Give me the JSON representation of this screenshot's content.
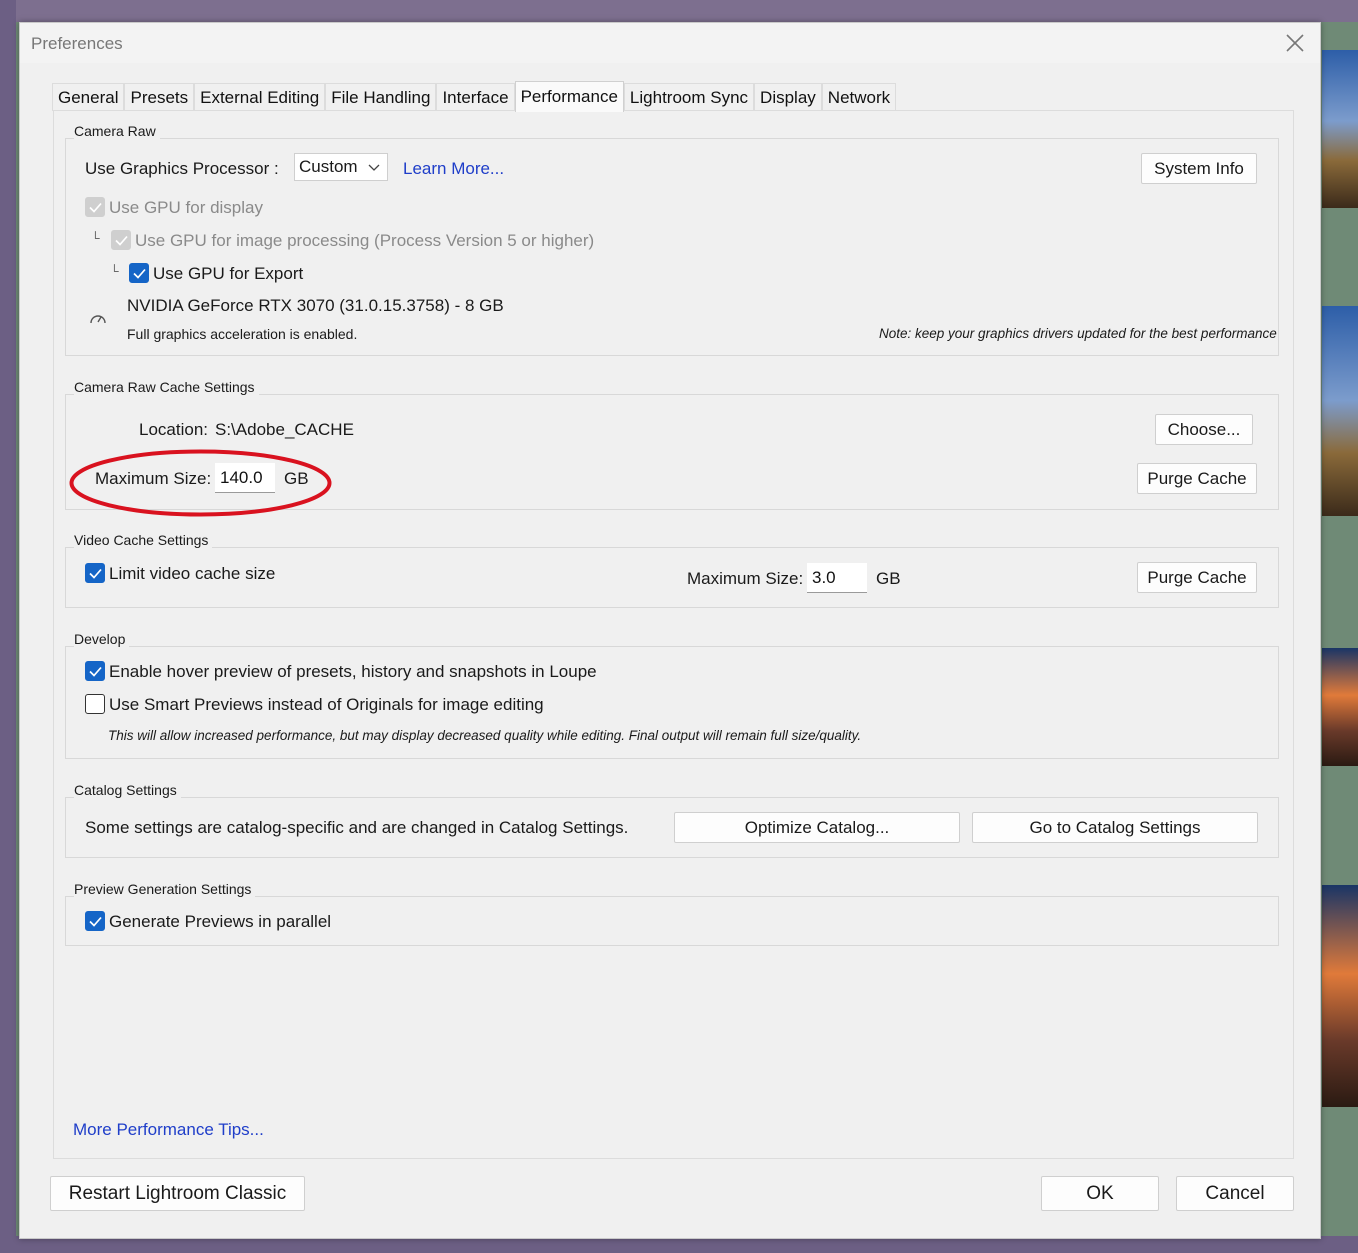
{
  "dialog": {
    "title": "Preferences"
  },
  "tabs": [
    {
      "label": "General"
    },
    {
      "label": "Presets"
    },
    {
      "label": "External Editing"
    },
    {
      "label": "File Handling"
    },
    {
      "label": "Interface"
    },
    {
      "label": "Performance"
    },
    {
      "label": "Lightroom Sync"
    },
    {
      "label": "Display"
    },
    {
      "label": "Network"
    }
  ],
  "active_tab": "Performance",
  "camera_raw": {
    "group_label": "Camera Raw",
    "use_gpu_label": "Use Graphics Processor :",
    "gpu_mode_value": "Custom",
    "learn_more": "Learn More...",
    "system_info_button": "System Info",
    "gpu_display": {
      "label": "Use GPU for display",
      "checked": true,
      "disabled": true
    },
    "gpu_processing": {
      "label": "Use GPU for image processing (Process Version 5 or higher)",
      "checked": true,
      "disabled": true
    },
    "gpu_export": {
      "label": "Use GPU for Export",
      "checked": true,
      "disabled": false
    },
    "gpu_name": "NVIDIA GeForce RTX 3070 (31.0.15.3758) - 8 GB",
    "acceleration_status": "Full graphics acceleration is enabled.",
    "driver_note": "Note: keep your graphics drivers updated for the best performance"
  },
  "camera_raw_cache": {
    "group_label": "Camera Raw Cache Settings",
    "location_label": "Location:",
    "location_value": "S:\\Adobe_CACHE",
    "choose_button": "Choose...",
    "max_size_label": "Maximum Size:",
    "max_size_value": "140.0",
    "max_size_unit": "GB",
    "purge_button": "Purge Cache"
  },
  "video_cache": {
    "group_label": "Video Cache Settings",
    "limit_label": "Limit video cache size",
    "limit_checked": true,
    "max_size_label": "Maximum Size:",
    "max_size_value": "3.0",
    "max_size_unit": "GB",
    "purge_button": "Purge Cache"
  },
  "develop": {
    "group_label": "Develop",
    "hover_preview": {
      "label": "Enable hover preview of presets, history and snapshots in Loupe",
      "checked": true
    },
    "smart_previews": {
      "label": "Use Smart Previews instead of Originals for image editing",
      "checked": false
    },
    "smart_previews_note": "This will allow increased performance, but may display decreased quality while editing. Final output will remain full size/quality."
  },
  "catalog": {
    "group_label": "Catalog Settings",
    "description": "Some settings are catalog-specific and are changed in Catalog Settings.",
    "optimize_button": "Optimize Catalog...",
    "goto_button": "Go to Catalog Settings"
  },
  "preview_generation": {
    "group_label": "Preview Generation Settings",
    "parallel": {
      "label": "Generate Previews in parallel",
      "checked": true
    }
  },
  "footer": {
    "more_tips": "More Performance Tips...",
    "restart_button": "Restart Lightroom Classic",
    "ok_button": "OK",
    "cancel_button": "Cancel"
  },
  "colors": {
    "accent": "#1565c7",
    "link": "#1f3ec9",
    "annotation": "#d9121f"
  }
}
